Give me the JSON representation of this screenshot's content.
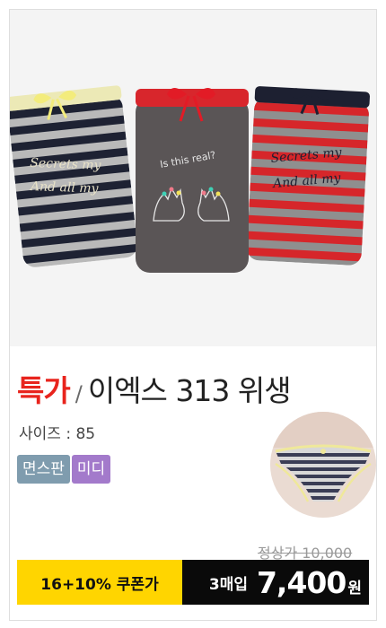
{
  "product": {
    "badge": "특가",
    "separator": "/",
    "name": "이엑스 313 위생",
    "size_label": "사이즈 : 85",
    "tags": [
      {
        "label": "면스판",
        "color": "#7f9cae"
      },
      {
        "label": "미디",
        "color": "#a37acb"
      }
    ],
    "regular_price": "정상가 10,000",
    "coupon_label": "16+10% 쿠폰가",
    "quantity": "3매입",
    "sale_price": "7,400",
    "currency": "원"
  },
  "photo": {
    "left_item": {
      "text_line1": "Secrets my",
      "text_line2": "And all my"
    },
    "center_item": {
      "text": "Is this real?"
    },
    "right_item": {
      "text_line1": "Secrets my",
      "text_line2": "And all my"
    }
  },
  "colors": {
    "badge": "#e8241d",
    "coupon_bg": "#ffd500",
    "price_bg": "#0a0a0a"
  }
}
